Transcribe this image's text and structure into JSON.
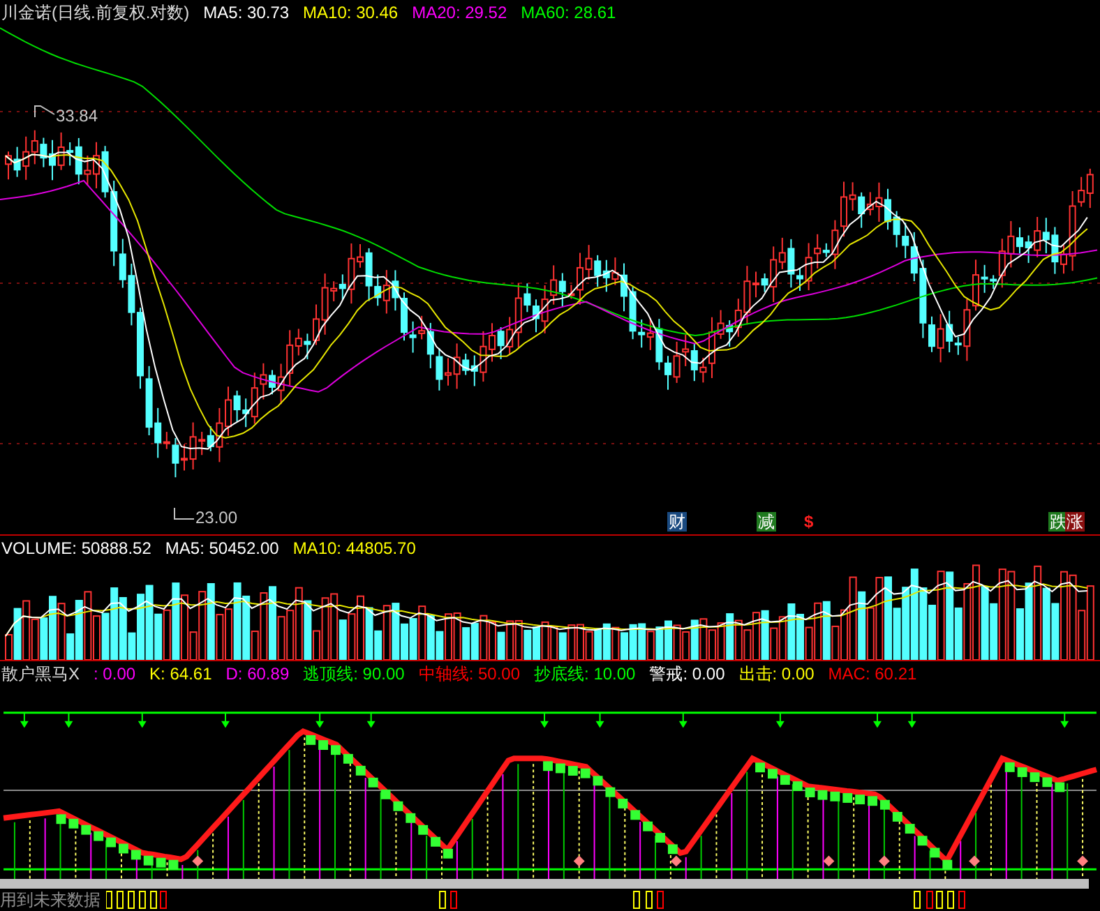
{
  "price_panel": {
    "title": "川金诺(日线.前复权.对数)",
    "legend": [
      {
        "text": "MA5: 30.73",
        "color": "#ffffff"
      },
      {
        "text": "MA10: 30.46",
        "color": "#ffff00"
      },
      {
        "text": "MA20: 29.52",
        "color": "#ff00ff"
      },
      {
        "text": "MA60: 28.61",
        "color": "#00ff00"
      }
    ],
    "high_label": "33.84",
    "low_label": "23.00",
    "markers": [
      {
        "text": "财",
        "color": "#1a4a80",
        "kind": "badge"
      },
      {
        "text": "减",
        "color": "#1f7a1f",
        "kind": "badge"
      },
      {
        "text": "$",
        "color": "#ff2020",
        "kind": "glyph"
      },
      {
        "text": "跌",
        "color": "#1f7a1f",
        "kind": "badge"
      },
      {
        "text": "涨",
        "color": "#8a1010",
        "kind": "badge"
      }
    ]
  },
  "volume_panel": {
    "legend": [
      {
        "text": "VOLUME: 50888.52",
        "color": "#ffffff"
      },
      {
        "text": "MA5: 50452.00",
        "color": "#ffffff"
      },
      {
        "text": "MA10: 44805.70",
        "color": "#ffff00"
      }
    ]
  },
  "indicator_panel": {
    "title": "散户黑马X",
    "legend": [
      {
        "text": ": 0.00",
        "color": "#ff00ff"
      },
      {
        "text": "K: 64.61",
        "color": "#ffff00"
      },
      {
        "text": "D: 60.89",
        "color": "#ff00ff"
      },
      {
        "text": "逃顶线: 90.00",
        "color": "#00ff00"
      },
      {
        "text": "中轴线: 50.00",
        "color": "#ff0000"
      },
      {
        "text": "抄底线: 10.00",
        "color": "#00ff00"
      },
      {
        "text": "警戒: 0.00",
        "color": "#ffffff"
      },
      {
        "text": "出击: 0.00",
        "color": "#ffff00"
      },
      {
        "text": "MAC: 60.21",
        "color": "#ff0000"
      }
    ]
  },
  "footer": {
    "label": "用到未来数据"
  }
}
